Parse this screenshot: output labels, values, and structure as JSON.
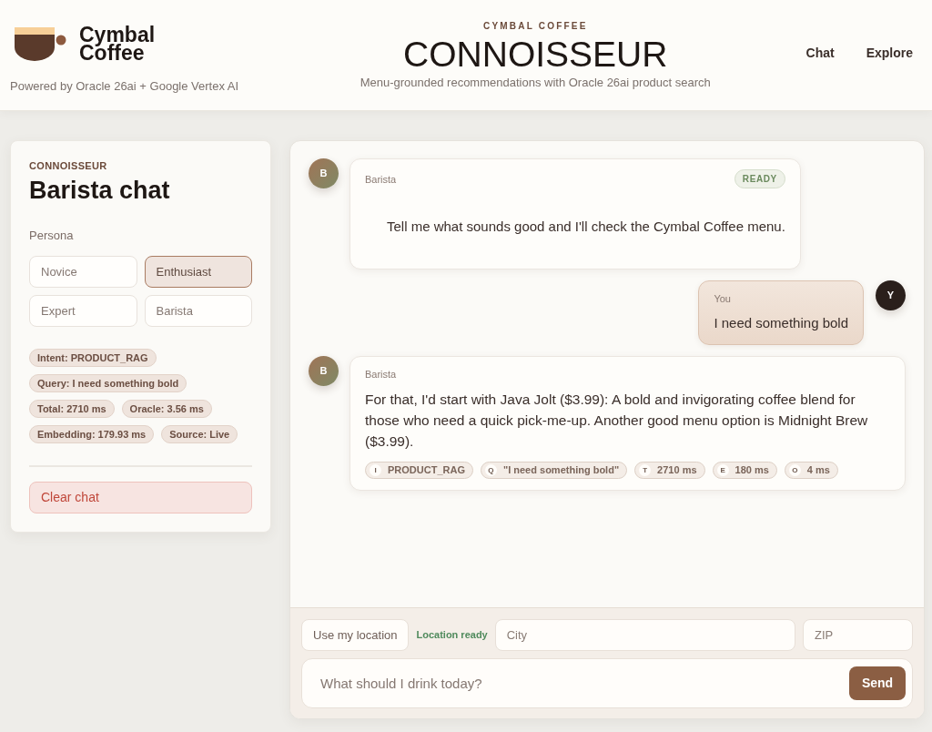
{
  "header": {
    "brand": "Cymbal Coffee",
    "powered_by": "Powered by Oracle 26ai + Google Vertex AI",
    "eyebrow": "CYMBAL COFFEE",
    "title": "CONNOISSEUR",
    "subtitle": "Menu-grounded recommendations with Oracle 26ai product search",
    "nav": [
      {
        "label": "Chat"
      },
      {
        "label": "Explore"
      }
    ]
  },
  "sidebar": {
    "eyebrow": "CONNOISSEUR",
    "title": "Barista chat",
    "persona_label": "Persona",
    "personas": [
      {
        "label": "Novice",
        "selected": false
      },
      {
        "label": "Enthusiast",
        "selected": true
      },
      {
        "label": "Expert",
        "selected": false
      },
      {
        "label": "Barista",
        "selected": false
      }
    ],
    "chips": [
      "Intent: PRODUCT_RAG",
      "Query: I need something bold",
      "Total: 2710 ms",
      "Oracle: 3.56 ms",
      "Embedding: 179.93 ms",
      "Source: Live"
    ],
    "clear_button": "Clear chat"
  },
  "chat": {
    "messages": [
      {
        "kind": "assistant",
        "avatar": "B",
        "sender": "Barista",
        "status": "READY",
        "text": "Tell me what sounds good and I'll check the Cymbal Coffee menu."
      },
      {
        "kind": "user",
        "avatar": "Y",
        "sender": "You",
        "text": "I need something bold"
      },
      {
        "kind": "assistant",
        "avatar": "B",
        "sender": "Barista",
        "text": "For that, I'd start with Java Jolt ($3.99): A bold and invigorating coffee blend for those who need a quick pick-me-up. Another good menu option is Midnight Brew ($3.99).",
        "tags": [
          {
            "key": "I",
            "value": "PRODUCT_RAG"
          },
          {
            "key": "Q",
            "value": "\"I need something bold\""
          },
          {
            "key": "T",
            "value": "2710 ms"
          },
          {
            "key": "E",
            "value": "180 ms"
          },
          {
            "key": "O",
            "value": "4 ms"
          }
        ]
      }
    ]
  },
  "composer": {
    "location_button": "Use my location",
    "location_status": "Location ready",
    "city": {
      "placeholder": "City"
    },
    "zip": {
      "placeholder": "ZIP"
    },
    "message": {
      "placeholder": "What should I drink today?"
    },
    "send_button": "Send"
  }
}
